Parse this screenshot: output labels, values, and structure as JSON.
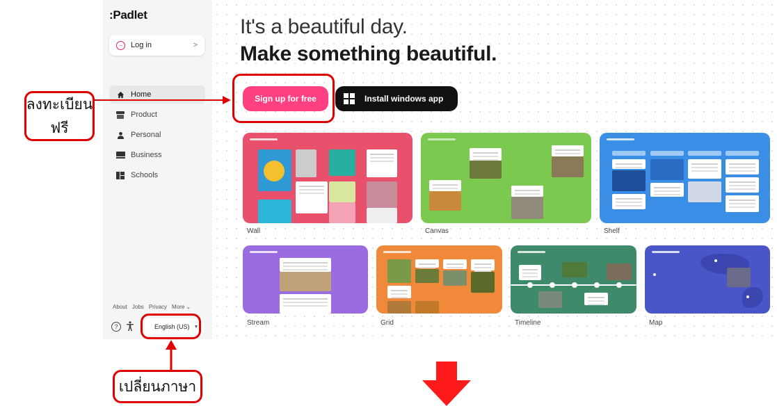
{
  "app": {
    "logo": ":Padlet"
  },
  "sidebar": {
    "login": {
      "label": "Log in",
      "chevron": ">"
    },
    "nav": [
      {
        "label": "Home",
        "icon": "home-icon",
        "active": true
      },
      {
        "label": "Product",
        "icon": "product-icon"
      },
      {
        "label": "Personal",
        "icon": "person-icon"
      },
      {
        "label": "Business",
        "icon": "business-icon"
      },
      {
        "label": "Schools",
        "icon": "schools-icon"
      }
    ],
    "footer_links": [
      "About",
      "Jobs",
      "Privacy",
      "More ⌄"
    ],
    "language": "English (US)"
  },
  "hero": {
    "line1": "It's a beautiful day.",
    "line2": "Make something beautiful."
  },
  "buttons": {
    "signup": "Sign up for free",
    "install": "Install windows app"
  },
  "templates": [
    {
      "label": "Wall",
      "color": "#e8506b"
    },
    {
      "label": "Canvas",
      "color": "#7cc94f"
    },
    {
      "label": "Shelf",
      "color": "#3a8ee6"
    },
    {
      "label": "Stream",
      "color": "#9b6be0"
    },
    {
      "label": "Grid",
      "color": "#f08a3a"
    },
    {
      "label": "Timeline",
      "color": "#3f8a6a"
    },
    {
      "label": "Map",
      "color": "#4a55c8"
    }
  ],
  "annotations": {
    "signup_note_line1": "ลงทะเบียน",
    "signup_note_line2": "ฟรี",
    "language_note": "เปลี่ยนภาษา"
  },
  "colors": {
    "brand_pink": "#ff4081",
    "annotation_red": "#e00000",
    "sidebar_bg": "#f5f5f5"
  }
}
